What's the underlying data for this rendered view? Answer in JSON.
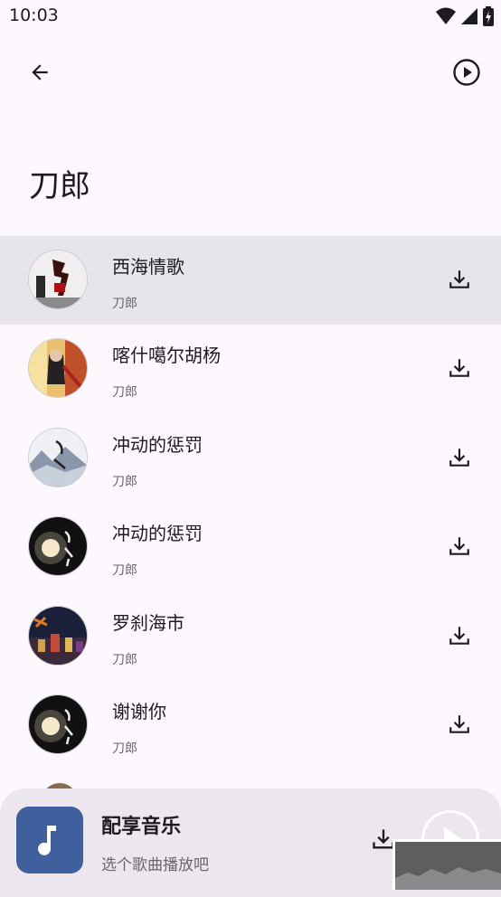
{
  "status_bar": {
    "time": "10:03"
  },
  "page": {
    "title": "刀郎"
  },
  "songs": [
    {
      "title": "西海情歌",
      "artist": "刀郎"
    },
    {
      "title": "喀什噶尔胡杨",
      "artist": "刀郎"
    },
    {
      "title": "冲动的惩罚",
      "artist": "刀郎"
    },
    {
      "title": "冲动的惩罚",
      "artist": "刀郎"
    },
    {
      "title": "罗刹海市",
      "artist": "刀郎"
    },
    {
      "title": "谢谢你",
      "artist": "刀郎"
    }
  ],
  "player": {
    "title": "配享音乐",
    "subtitle": "选个歌曲播放吧"
  },
  "icons": {
    "back": "arrow-left-icon",
    "play_all": "play-circle-icon",
    "download": "download-icon",
    "music_note": "music-note-icon"
  },
  "colors": {
    "background": "#fdf7fe",
    "selected_row": "#e8e4eb",
    "player_bar": "#ece6ee",
    "player_cover": "#3f5f9d"
  }
}
